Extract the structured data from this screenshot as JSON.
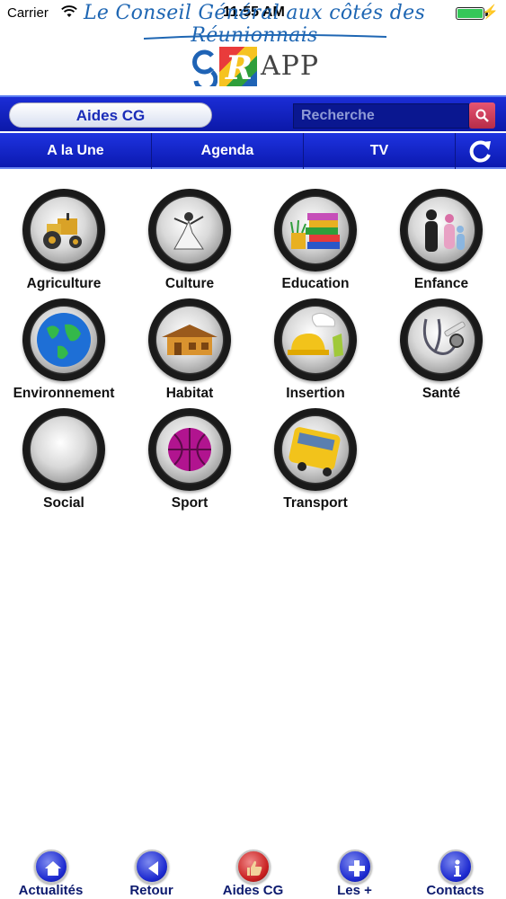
{
  "status_bar": {
    "carrier": "Carrier",
    "time": "11:55 AM"
  },
  "header": {
    "banner_title": "Le Conseil Général aux côtés des Réunionnais",
    "logo_letter": "R",
    "logo_text": "APP"
  },
  "top_bar": {
    "section_label": "Aides CG",
    "search_placeholder": "Recherche"
  },
  "nav_tabs": [
    {
      "label": "A la Une"
    },
    {
      "label": "Agenda"
    },
    {
      "label": "TV"
    }
  ],
  "categories": [
    {
      "label": "Agriculture",
      "icon": "tractor-icon"
    },
    {
      "label": "Culture",
      "icon": "dancer-icon"
    },
    {
      "label": "Education",
      "icon": "books-icon"
    },
    {
      "label": "Enfance",
      "icon": "family-icon"
    },
    {
      "label": "Environnement",
      "icon": "globe-icon"
    },
    {
      "label": "Habitat",
      "icon": "house-icon"
    },
    {
      "label": "Insertion",
      "icon": "work-helmet-icon"
    },
    {
      "label": "Santé",
      "icon": "stethoscope-icon"
    },
    {
      "label": "Social",
      "icon": "social-icon"
    },
    {
      "label": "Sport",
      "icon": "ball-icon"
    },
    {
      "label": "Transport",
      "icon": "bus-icon"
    }
  ],
  "bottom_bar": [
    {
      "label": "Actualités",
      "icon": "home-icon"
    },
    {
      "label": "Retour",
      "icon": "back-arrow-icon"
    },
    {
      "label": "Aides CG",
      "icon": "thumbs-up-icon"
    },
    {
      "label": "Les +",
      "icon": "plus-icon"
    },
    {
      "label": "Contacts",
      "icon": "info-icon"
    }
  ],
  "colors": {
    "nav_blue": "#1b2dd6",
    "search_button": "#c83a56",
    "title_blue": "#1e66b3"
  }
}
